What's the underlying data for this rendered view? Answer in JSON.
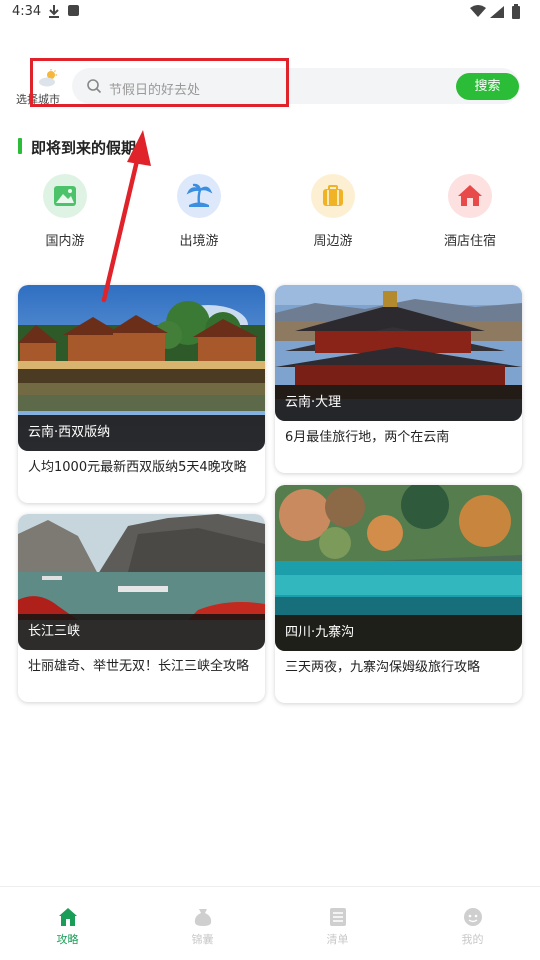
{
  "status_bar": {
    "time": "4:34"
  },
  "header": {
    "city_label": "选择城市",
    "search_placeholder": "节假日的好去处",
    "search_button": "搜索"
  },
  "section": {
    "title": "即将到来的假期"
  },
  "categories": [
    {
      "label": "国内游",
      "icon": "mountain-icon",
      "color": "#4cc26a",
      "bg": "#dff3e4"
    },
    {
      "label": "出境游",
      "icon": "palm-island-icon",
      "color": "#3a8fe0",
      "bg": "#dde9fb"
    },
    {
      "label": "周边游",
      "icon": "suitcase-icon",
      "color": "#f0b326",
      "bg": "#fdf0d2"
    },
    {
      "label": "酒店住宿",
      "icon": "house-icon",
      "color": "#e84a4a",
      "bg": "#fde0e0"
    }
  ],
  "cards": [
    {
      "place": "云南·西双版纳",
      "desc": "人均1000元最新西双版纳5天4晚攻略"
    },
    {
      "place": "云南·大理",
      "desc": "6月最佳旅行地，两个在云南"
    },
    {
      "place": "长江三峡",
      "desc": "壮丽雄奇、举世无双！长江三峡全攻略"
    },
    {
      "place": "四川·九寨沟",
      "desc": "三天两夜，九寨沟保姆级旅行攻略"
    }
  ],
  "bottom_nav": [
    {
      "label": "攻略",
      "icon": "home-icon",
      "active": true
    },
    {
      "label": "锦囊",
      "icon": "pouch-icon",
      "active": false
    },
    {
      "label": "清单",
      "icon": "list-icon",
      "active": false
    },
    {
      "label": "我的",
      "icon": "profile-icon",
      "active": false
    }
  ],
  "colors": {
    "accent": "#2bbd37",
    "nav_active": "#1a9e57",
    "annotation": "#e0232a"
  }
}
